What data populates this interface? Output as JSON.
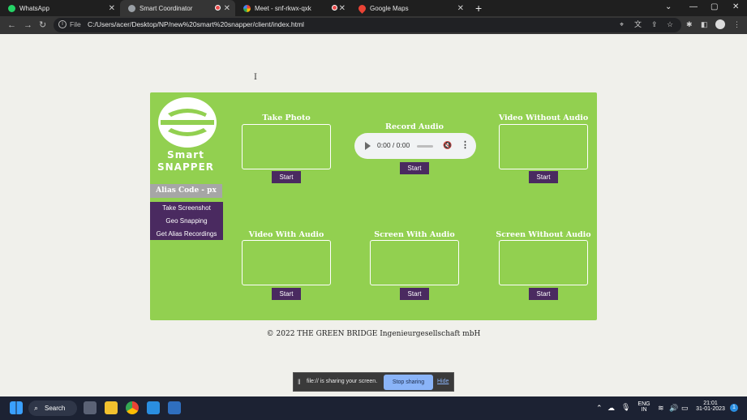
{
  "browser": {
    "tabs": [
      {
        "label": "WhatsApp",
        "active": false
      },
      {
        "label": "Smart Coordinator",
        "active": true
      },
      {
        "label": "Meet - snf-rkwx-qxk",
        "active": false
      },
      {
        "label": "Google Maps",
        "active": false
      }
    ],
    "address": {
      "scheme": "File",
      "url": "C:/Users/acer/Desktop/NP/new%20smart%20snapper/client/index.html"
    }
  },
  "sidebar": {
    "brand_line1": "Smart",
    "brand_line2": "SNAPPER",
    "alias_code": "Alias Code - px",
    "menu": [
      "Take Screenshot",
      "Geo Snapping",
      "Get Alias Recordings"
    ]
  },
  "cards": [
    {
      "title": "Take Photo",
      "button": "Start"
    },
    {
      "title": "Record Audio",
      "button": "Start"
    },
    {
      "title": "Video Without Audio",
      "button": "Start"
    },
    {
      "title": "Video With Audio",
      "button": "Start"
    },
    {
      "title": "Screen With Audio",
      "button": "Start"
    },
    {
      "title": "Screen Without Audio",
      "button": "Start"
    }
  ],
  "audio_player": {
    "time": "0:00 / 0:00"
  },
  "footer": "© 2022 THE GREEN BRIDGE Ingenieurgesellschaft mbH",
  "share_bar": {
    "message": "file:// is sharing your screen.",
    "stop_label": "Stop sharing",
    "hide_label": "Hide"
  },
  "taskbar": {
    "search_label": "Search",
    "lang_line1": "ENG",
    "lang_line2": "IN",
    "time": "21:01",
    "date": "31-01-2023",
    "notification_count": "1"
  },
  "colors": {
    "panel": "#92d050",
    "menu": "#4a2a60",
    "button": "#4a2a60",
    "alias_bg": "#a6a6a6"
  }
}
